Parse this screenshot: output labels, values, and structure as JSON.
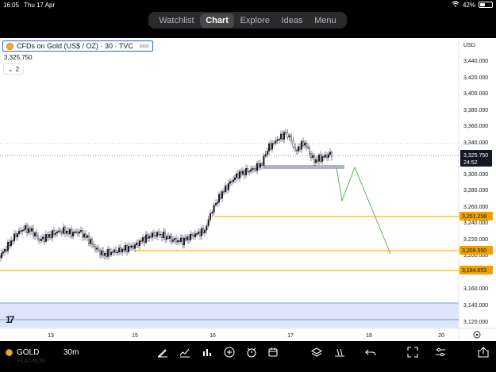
{
  "status_bar": {
    "time": "16:05",
    "date": "Thu 17 Apr",
    "battery": "42%",
    "battery_level": 0.42
  },
  "top_nav": {
    "tabs": [
      {
        "label": "Watchlist",
        "active": false
      },
      {
        "label": "Chart",
        "active": true
      },
      {
        "label": "Explore",
        "active": false
      },
      {
        "label": "Ideas",
        "active": false
      },
      {
        "label": "Menu",
        "active": false
      }
    ]
  },
  "legend": {
    "symbol_title": "CFDs on Gold (US$ / OZ) · 30 · TVC",
    "more": "ooo",
    "last_price": "3,325.750",
    "indicator_count": "2"
  },
  "price_scale": {
    "currency": "USD",
    "ticks": [
      "3,440.000",
      "3,420.000",
      "3,400.000",
      "3,380.000",
      "3,360.000",
      "3,340.000",
      "3,300.000",
      "3,280.000",
      "3,260.000",
      "3,240.000",
      "3,220.000",
      "3,200.000",
      "3,180.000",
      "3,160.000",
      "3,140.000",
      "3,120.000"
    ],
    "labels": {
      "current": "3,325.750",
      "countdown": "24:52",
      "level_1": "3,251.258",
      "level_2": "3,209.550",
      "level_3": "3,184.653"
    }
  },
  "time_scale": {
    "ticks": [
      "13",
      "15",
      "16",
      "17",
      "18",
      "20"
    ]
  },
  "colors": {
    "accent": "#2962ff",
    "level_line": "#f0a100",
    "forecast_line": "#4caf50",
    "zone_fill": "#dde5fb",
    "zone_edge": "#5b7bd5",
    "support_bar": "#b2b5be",
    "current_price_bg": "#131722"
  },
  "bottom_bar": {
    "symbol": "GOLD",
    "interval": "30m",
    "ghost_text": "PLATINUM",
    "icons": [
      "drawing-pen-icon",
      "indicators-icon",
      "compare-icon",
      "add-icon",
      "alert-icon",
      "object-tree-icon",
      "layers-icon",
      "replay-icon",
      "undo-icon",
      "fullscreen-icon",
      "settings-icon",
      "share-icon"
    ]
  }
}
